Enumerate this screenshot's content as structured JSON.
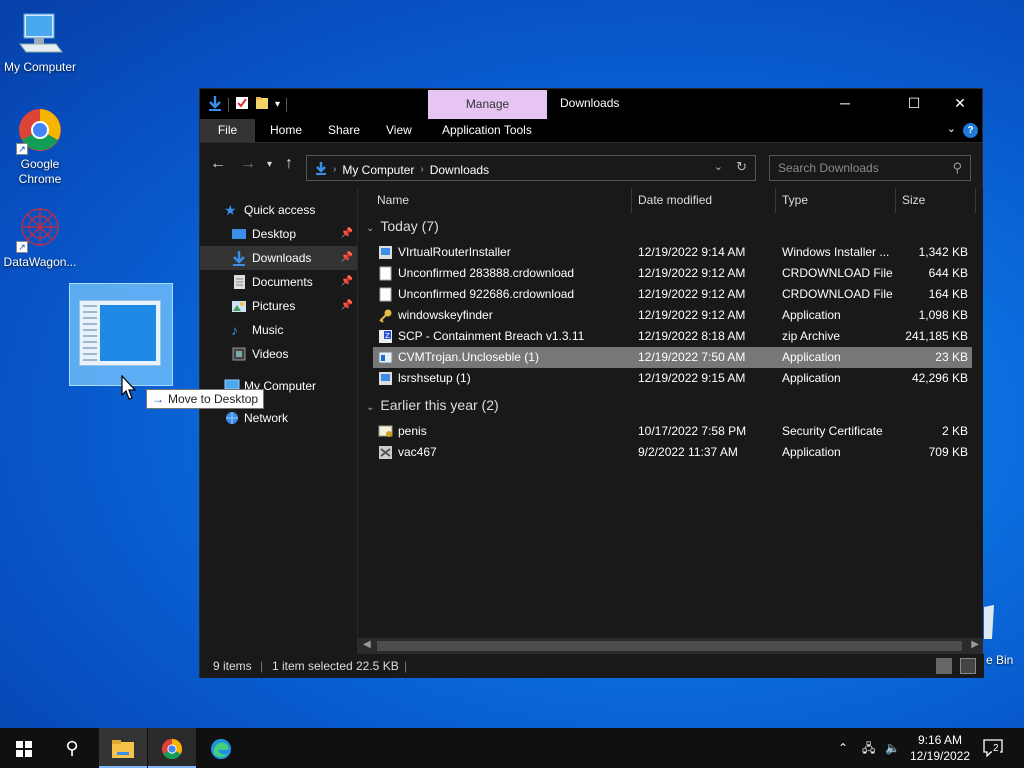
{
  "desktop": {
    "icons": [
      {
        "label": "My Computer",
        "icon": "computer-icon"
      },
      {
        "label": "Google Chrome",
        "icon": "chrome-icon"
      },
      {
        "label": "DataWagon...",
        "icon": "datawagon-icon"
      }
    ],
    "drag_tooltip": "Move to Desktop",
    "recycle_bin_label": "e Bin"
  },
  "window": {
    "title": "Downloads",
    "context_tab": "Manage",
    "ribbon_tabs": [
      "File",
      "Home",
      "Share",
      "View",
      "Application Tools"
    ],
    "address": {
      "crumbs": [
        "My Computer",
        "Downloads"
      ]
    },
    "search_placeholder": "Search Downloads",
    "sidebar": [
      {
        "label": "Quick access",
        "icon": "star-icon"
      },
      {
        "label": "Desktop",
        "icon": "desktop-folder-icon",
        "pinned": true
      },
      {
        "label": "Downloads",
        "icon": "download-arrow-icon",
        "pinned": true,
        "selected": true
      },
      {
        "label": "Documents",
        "icon": "documents-icon",
        "pinned": true
      },
      {
        "label": "Pictures",
        "icon": "pictures-icon",
        "pinned": true
      },
      {
        "label": "Music",
        "icon": "music-note-icon"
      },
      {
        "label": "Videos",
        "icon": "videos-icon"
      },
      {
        "label": "My Computer",
        "icon": "computer-icon"
      },
      {
        "label": "Network",
        "icon": "network-icon"
      }
    ],
    "columns": [
      "Name",
      "Date modified",
      "Type",
      "Size"
    ],
    "groups": [
      {
        "label": "Today (7)",
        "rows": [
          {
            "name": "VIrtualRouterInstaller",
            "date": "12/19/2022 9:14 AM",
            "type": "Windows Installer ...",
            "size": "1,342 KB",
            "icon": "installer-icon"
          },
          {
            "name": "Unconfirmed 283888.crdownload",
            "date": "12/19/2022 9:12 AM",
            "type": "CRDOWNLOAD File",
            "size": "644 KB",
            "icon": "blank-file-icon"
          },
          {
            "name": "Unconfirmed 922686.crdownload",
            "date": "12/19/2022 9:12 AM",
            "type": "CRDOWNLOAD File",
            "size": "164 KB",
            "icon": "blank-file-icon"
          },
          {
            "name": "windowskeyfinder",
            "date": "12/19/2022 9:12 AM",
            "type": "Application",
            "size": "1,098 KB",
            "icon": "key-icon"
          },
          {
            "name": "SCP - Containment Breach v1.3.11",
            "date": "12/19/2022 8:18 AM",
            "type": "zip Archive",
            "size": "241,185 KB",
            "icon": "zip-icon"
          },
          {
            "name": "CVMTrojan.Uncloseble (1)",
            "date": "12/19/2022 7:50 AM",
            "type": "Application",
            "size": "23 KB",
            "icon": "app-window-icon",
            "selected": true
          },
          {
            "name": "lsrshsetup (1)",
            "date": "12/19/2022 9:15 AM",
            "type": "Application",
            "size": "42,296 KB",
            "icon": "installer-icon"
          }
        ]
      },
      {
        "label": "Earlier this year (2)",
        "rows": [
          {
            "name": "penis",
            "date": "10/17/2022 7:58 PM",
            "type": "Security Certificate",
            "size": "2 KB",
            "icon": "certificate-icon"
          },
          {
            "name": "vac467",
            "date": "9/2/2022 11:37 AM",
            "type": "Application",
            "size": "709 KB",
            "icon": "setup-icon"
          }
        ]
      }
    ],
    "status": {
      "items": "9 items",
      "selected": "1 item selected",
      "size": "22.5 KB"
    }
  },
  "taskbar": {
    "time": "9:16 AM",
    "date": "12/19/2022",
    "notification_count": "2"
  },
  "colors": {
    "accent": "#1e7ad6",
    "manage_tab": "#e6c5f5",
    "selected_row": "#777777"
  }
}
